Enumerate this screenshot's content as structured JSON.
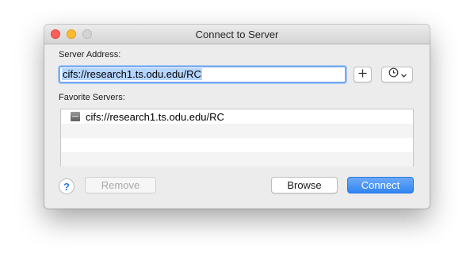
{
  "window": {
    "title": "Connect to Server"
  },
  "server_address": {
    "label": "Server Address:",
    "value": "cifs://research1.ts.odu.edu/RC",
    "add_icon": "plus-icon",
    "recent_icon": "clock-icon"
  },
  "favorites": {
    "label": "Favorite Servers:",
    "items": [
      {
        "label": "cifs://research1.ts.odu.edu/RC",
        "icon": "network-drive-icon"
      }
    ]
  },
  "buttons": {
    "help": "?",
    "remove": "Remove",
    "browse": "Browse",
    "connect": "Connect"
  },
  "colors": {
    "accent": "#3185f2",
    "selection": "#b5d5ff",
    "close": "#fc5f57",
    "minimize": "#fdbc2e",
    "zoom_disabled": "#d4d4d4"
  }
}
